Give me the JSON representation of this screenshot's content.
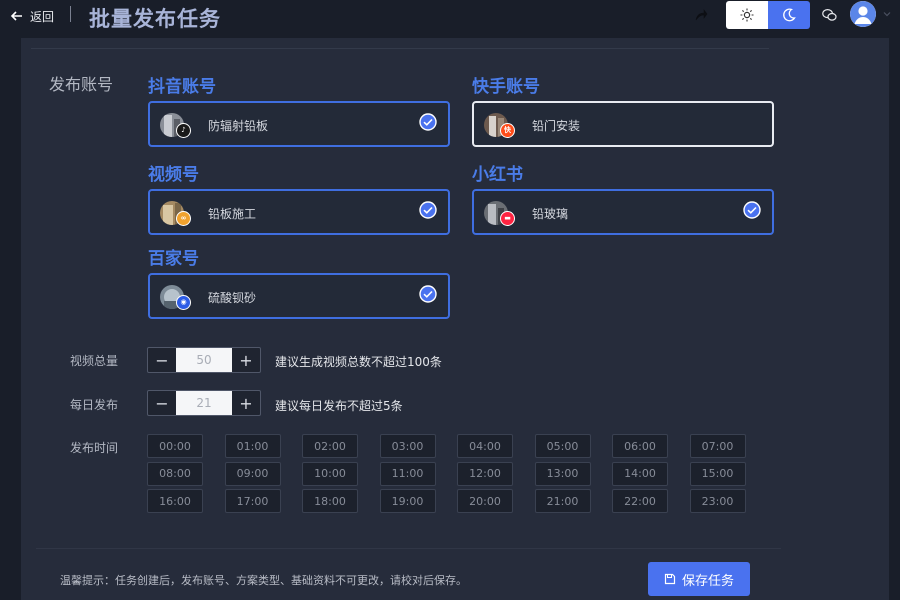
{
  "header": {
    "back_label": "返回",
    "title": "批量发布任务",
    "icons": [
      "arrow-left-icon",
      "share-icon",
      "sun-icon",
      "moon-icon",
      "wechat-icon",
      "user-avatar",
      "chevron-down-icon"
    ]
  },
  "form": {
    "accounts_label": "发布账号",
    "platforms": [
      {
        "name": "抖音账号",
        "account": "防辐射铅板",
        "selected": true,
        "badge_icon": "douyin-icon",
        "badge_color": "#1a1a1a"
      },
      {
        "name": "快手账号",
        "account": "铅门安装",
        "selected": false,
        "badge_icon": "kuaishou-icon",
        "badge_color": "#ff4d1a"
      },
      {
        "name": "视频号",
        "account": "铅板施工",
        "selected": true,
        "badge_icon": "shipinhao-icon",
        "badge_color": "#f0a22e"
      },
      {
        "name": "小红书",
        "account": "铅玻璃",
        "selected": true,
        "badge_icon": "xiaohongshu-icon",
        "badge_color": "#ff2442"
      },
      {
        "name": "百家号",
        "account": "硫酸钡砂",
        "selected": true,
        "badge_icon": "baijiahao-icon",
        "badge_color": "#2d5ce6"
      }
    ],
    "video_total": {
      "label": "视频总量",
      "value": "50",
      "minus": "−",
      "plus": "+",
      "hint": "建议生成视频总数不超过100条"
    },
    "daily_publish": {
      "label": "每日发布",
      "value": "21",
      "minus": "−",
      "plus": "+",
      "hint": "建议每日发布不超过5条"
    },
    "publish_time": {
      "label": "发布时间",
      "slots": [
        "00:00",
        "01:00",
        "02:00",
        "03:00",
        "04:00",
        "05:00",
        "06:00",
        "07:00",
        "08:00",
        "09:00",
        "10:00",
        "11:00",
        "12:00",
        "13:00",
        "14:00",
        "15:00",
        "16:00",
        "17:00",
        "18:00",
        "19:00",
        "20:00",
        "21:00",
        "22:00",
        "23:00"
      ]
    }
  },
  "footer": {
    "tip": "温馨提示：任务创建后，发布账号、方案类型、基础资料不可更改，请校对后保存。",
    "save_label": "保存任务"
  },
  "colors": {
    "accent": "#4a72ef",
    "platform_title": "#4a7ce8",
    "selected_border": "#3f6ee0",
    "unselected_border": "#e8ebf1",
    "background": "#191e29",
    "panel": "#262c3b"
  }
}
